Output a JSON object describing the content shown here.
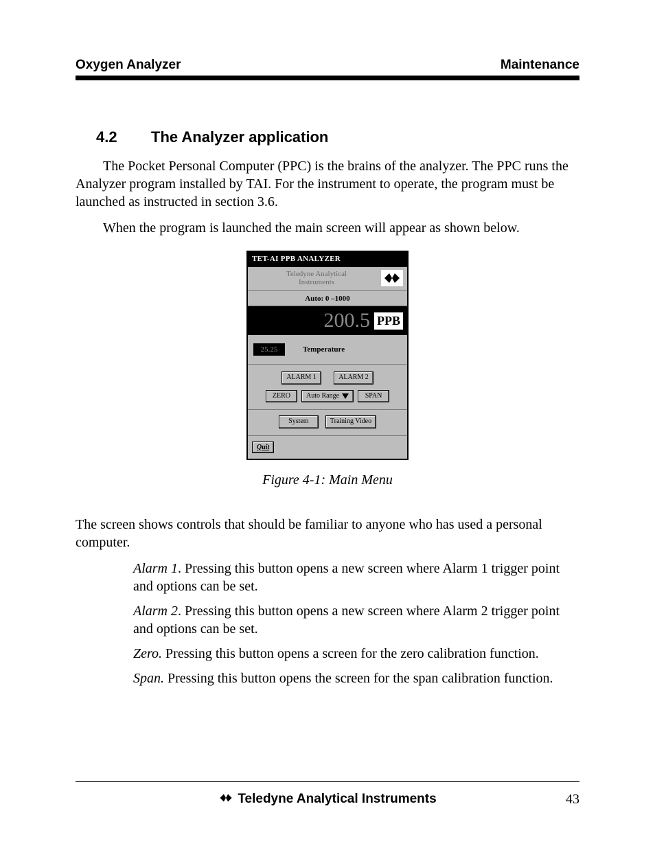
{
  "header": {
    "left": "Oxygen Analyzer",
    "right": "Maintenance"
  },
  "section": {
    "number": "4.2",
    "title": "The Analyzer application"
  },
  "para1": "The Pocket Personal Computer  (PPC) is the brains of the analyzer. The PPC runs the Analyzer program installed by TAI. For the instrument to operate, the program must be launched as instructed in section 3.6.",
  "para2": "When the program is launched the main screen will appear as shown below.",
  "device": {
    "titlebar": "TET-AI PPB ANALYZER",
    "subheader_line1": "Teledyne Analytical",
    "subheader_line2": "Instruments",
    "auto_label": "Auto: 0 –1000",
    "readout_value": "200.5",
    "readout_unit": "PPB",
    "temp_value": "25.25",
    "temp_label": "Temperature",
    "alarm1": "ALARM 1",
    "alarm2": "ALARM 2",
    "zero": "ZERO",
    "autorange": "Auto Range",
    "span": "SPAN",
    "system": "System",
    "training": "Training Video",
    "quit": "Quit"
  },
  "figure_caption": "Figure 4-1: Main Menu",
  "para3": "The screen shows controls that should be familiar to anyone who has used a personal computer.",
  "desc": {
    "alarm1_term": "Alarm 1",
    "alarm1_text": ". Pressing this button opens a new screen where Alarm 1 trigger point and options can be set.",
    "alarm2_term": "Alarm 2",
    "alarm2_text": ". Pressing this button opens a new screen where Alarm 2 trigger point and options can be set.",
    "zero_term": "Zero.",
    "zero_text": " Pressing this button opens a screen for the zero calibration function.",
    "span_term": "Span.",
    "span_text": " Pressing this button opens the screen for the span calibration function."
  },
  "footer": {
    "brand": "Teledyne Analytical Instruments",
    "page": "43"
  }
}
